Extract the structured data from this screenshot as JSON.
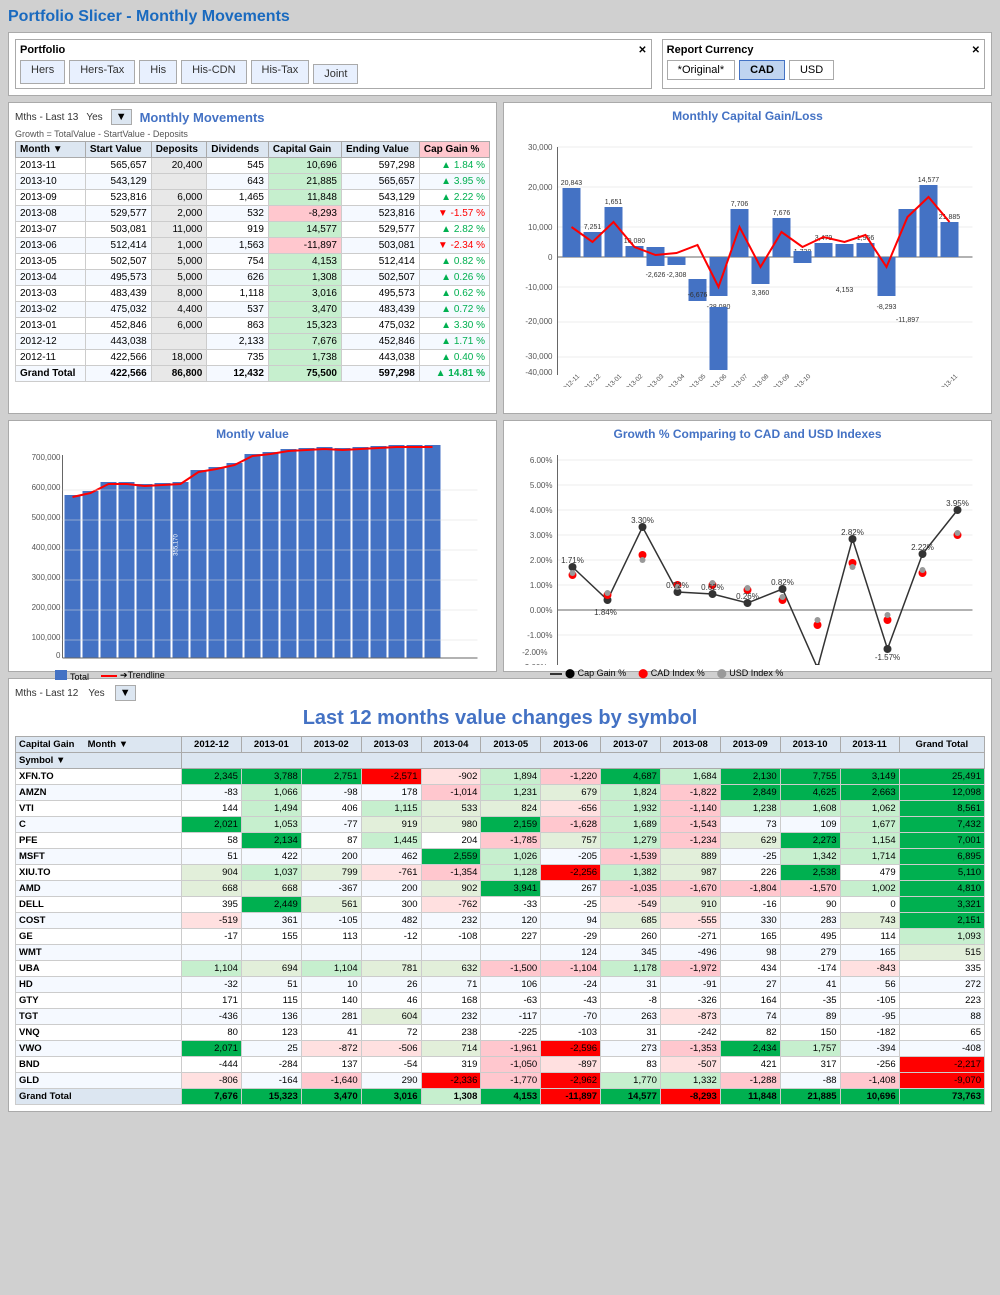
{
  "title": "Portfolio Slicer - Monthly Movements",
  "portfolio_slicer": {
    "label": "Portfolio",
    "items": [
      "Hers",
      "Hers-Tax",
      "His",
      "His-CDN",
      "His-Tax",
      "Joint"
    ]
  },
  "report_currency": {
    "label": "Report Currency",
    "items": [
      "*Original*",
      "CAD",
      "USD"
    ],
    "selected": "CAD"
  },
  "monthly_movements": {
    "title": "Monthly Movements",
    "filter_label": "Mths - Last 13",
    "filter_yes": "Yes",
    "note": "Growth = TotalValue - StartValue - Deposits",
    "columns": [
      "Month",
      "Start Value",
      "Deposits",
      "Dividends",
      "Capital Gain",
      "Ending Value",
      "Cap Gain %"
    ],
    "rows": [
      {
        "month": "2013-11",
        "start": "565,657",
        "deposits": "20,400",
        "dividends": "545",
        "cap_gain": "10,696",
        "ending": "597,298",
        "pct": "1.84 %",
        "dir": "up"
      },
      {
        "month": "2013-10",
        "start": "543,129",
        "deposits": "",
        "dividends": "643",
        "cap_gain": "21,885",
        "ending": "565,657",
        "pct": "3.95 %",
        "dir": "up"
      },
      {
        "month": "2013-09",
        "start": "523,816",
        "deposits": "6,000",
        "dividends": "1,465",
        "cap_gain": "11,848",
        "ending": "543,129",
        "pct": "2.22 %",
        "dir": "up"
      },
      {
        "month": "2013-08",
        "start": "529,577",
        "deposits": "2,000",
        "dividends": "532",
        "cap_gain": "-8,293",
        "ending": "523,816",
        "pct": "-1.57 %",
        "dir": "down"
      },
      {
        "month": "2013-07",
        "start": "503,081",
        "deposits": "11,000",
        "dividends": "919",
        "cap_gain": "14,577",
        "ending": "529,577",
        "pct": "2.82 %",
        "dir": "up"
      },
      {
        "month": "2013-06",
        "start": "512,414",
        "deposits": "1,000",
        "dividends": "1,563",
        "cap_gain": "-11,897",
        "ending": "503,081",
        "pct": "-2.34 %",
        "dir": "down"
      },
      {
        "month": "2013-05",
        "start": "502,507",
        "deposits": "5,000",
        "dividends": "754",
        "cap_gain": "4,153",
        "ending": "512,414",
        "pct": "0.82 %",
        "dir": "up"
      },
      {
        "month": "2013-04",
        "start": "495,573",
        "deposits": "5,000",
        "dividends": "626",
        "cap_gain": "1,308",
        "ending": "502,507",
        "pct": "0.26 %",
        "dir": "up"
      },
      {
        "month": "2013-03",
        "start": "483,439",
        "deposits": "8,000",
        "dividends": "1,118",
        "cap_gain": "3,016",
        "ending": "495,573",
        "pct": "0.62 %",
        "dir": "up"
      },
      {
        "month": "2013-02",
        "start": "475,032",
        "deposits": "4,400",
        "dividends": "537",
        "cap_gain": "3,470",
        "ending": "483,439",
        "pct": "0.72 %",
        "dir": "up"
      },
      {
        "month": "2013-01",
        "start": "452,846",
        "deposits": "6,000",
        "dividends": "863",
        "cap_gain": "15,323",
        "ending": "475,032",
        "pct": "3.30 %",
        "dir": "up"
      },
      {
        "month": "2012-12",
        "start": "443,038",
        "deposits": "",
        "dividends": "2,133",
        "cap_gain": "7,676",
        "ending": "452,846",
        "pct": "1.71 %",
        "dir": "up"
      },
      {
        "month": "2012-11",
        "start": "422,566",
        "deposits": "18,000",
        "dividends": "735",
        "cap_gain": "1,738",
        "ending": "443,038",
        "pct": "0.40 %",
        "dir": "up"
      }
    ],
    "grand_total": {
      "start": "422,566",
      "deposits": "86,800",
      "dividends": "12,432",
      "cap_gain": "75,500",
      "ending": "597,298",
      "pct": "14.81 %"
    }
  },
  "last12_section": {
    "filter_label": "Mths - Last 12",
    "filter_yes": "Yes",
    "title": "Last 12 months value changes by symbol",
    "col_header": "Capital Gain",
    "month_header": "Month",
    "columns": [
      "Symbol",
      "2012-12",
      "2013-01",
      "2013-02",
      "2013-03",
      "2013-04",
      "2013-05",
      "2013-06",
      "2013-07",
      "2013-08",
      "2013-09",
      "2013-10",
      "2013-11",
      "Grand Total"
    ],
    "rows": [
      {
        "symbol": "XFN.TO",
        "vals": [
          2345,
          3788,
          2751,
          -2571,
          -902,
          1894,
          -1220,
          4687,
          1684,
          2130,
          7755,
          3149,
          25491
        ]
      },
      {
        "symbol": "AMZN",
        "vals": [
          -83,
          1066,
          -98,
          178,
          -1014,
          1231,
          679,
          1824,
          -1822,
          2849,
          4625,
          2663,
          12098
        ]
      },
      {
        "symbol": "VTI",
        "vals": [
          144,
          1494,
          406,
          1115,
          533,
          824,
          -656,
          1932,
          -1140,
          1238,
          1608,
          1062,
          8561
        ]
      },
      {
        "symbol": "C",
        "vals": [
          2021,
          1053,
          -77,
          919,
          980,
          2159,
          -1628,
          1689,
          -1543,
          73,
          109,
          1677,
          7432
        ]
      },
      {
        "symbol": "PFE",
        "vals": [
          58,
          2134,
          87,
          1445,
          204,
          -1785,
          757,
          1279,
          -1234,
          629,
          2273,
          1154,
          7001
        ]
      },
      {
        "symbol": "MSFT",
        "vals": [
          51,
          422,
          200,
          462,
          2559,
          1026,
          -205,
          -1539,
          889,
          -25,
          1342,
          1714,
          6895
        ]
      },
      {
        "symbol": "XIU.TO",
        "vals": [
          904,
          1037,
          799,
          -761,
          -1354,
          1128,
          -2256,
          1382,
          987,
          226,
          2538,
          479,
          5110
        ]
      },
      {
        "symbol": "AMD",
        "vals": [
          668,
          668,
          -367,
          200,
          902,
          3941,
          267,
          -1035,
          -1670,
          -1804,
          -1570,
          1002,
          4810
        ]
      },
      {
        "symbol": "DELL",
        "vals": [
          395,
          2449,
          561,
          300,
          -762,
          -33,
          -25,
          -549,
          910,
          -16,
          90,
          0,
          3321
        ]
      },
      {
        "symbol": "COST",
        "vals": [
          -519,
          361,
          -105,
          482,
          232,
          120,
          94,
          685,
          -555,
          330,
          283,
          743,
          2151
        ]
      },
      {
        "symbol": "GE",
        "vals": [
          -17,
          155,
          113,
          -12,
          -108,
          227,
          -29,
          260,
          -271,
          165,
          495,
          114,
          1093
        ]
      },
      {
        "symbol": "WMT",
        "vals": [
          null,
          null,
          null,
          null,
          null,
          null,
          124,
          345,
          -496,
          98,
          279,
          165,
          515
        ]
      },
      {
        "symbol": "UBA",
        "vals": [
          1104,
          694,
          1104,
          781,
          632,
          -1500,
          -1104,
          1178,
          -1972,
          434,
          -174,
          -843,
          335
        ]
      },
      {
        "symbol": "HD",
        "vals": [
          -32,
          51,
          10,
          26,
          71,
          106,
          -24,
          31,
          -91,
          27,
          41,
          56,
          272
        ]
      },
      {
        "symbol": "GTY",
        "vals": [
          171,
          115,
          140,
          46,
          168,
          -63,
          -43,
          -8,
          -326,
          164,
          -35,
          -105,
          223
        ]
      },
      {
        "symbol": "TGT",
        "vals": [
          -436,
          136,
          281,
          604,
          232,
          -117,
          -70,
          263,
          -873,
          74,
          89,
          -95,
          88
        ]
      },
      {
        "symbol": "VNQ",
        "vals": [
          80,
          123,
          41,
          72,
          238,
          -225,
          -103,
          31,
          -242,
          82,
          150,
          -182,
          65
        ]
      },
      {
        "symbol": "VWO",
        "vals": [
          2071,
          25,
          -872,
          -506,
          714,
          -1961,
          -2596,
          273,
          -1353,
          2434,
          1757,
          -394,
          -408
        ]
      },
      {
        "symbol": "BND",
        "vals": [
          -444,
          -284,
          137,
          -54,
          319,
          -1050,
          -897,
          83,
          -507,
          421,
          317,
          -256,
          -2217
        ]
      },
      {
        "symbol": "GLD",
        "vals": [
          -806,
          -164,
          -1640,
          290,
          -2336,
          -1770,
          -2962,
          1770,
          1332,
          -1288,
          -88,
          -1408,
          -9070
        ]
      }
    ],
    "grand_total_row": [
      7676,
      15323,
      3470,
      3016,
      1308,
      4153,
      -11897,
      14577,
      -8293,
      11848,
      21885,
      10696,
      73763
    ]
  },
  "monthly_chart": {
    "title": "Monthly Capital Gain/Loss",
    "bar_values": [
      20843,
      1651,
      -2626,
      -2308,
      -6676,
      -28080,
      1738,
      3470,
      1308,
      4153,
      -11897,
      14577,
      -8293,
      11848,
      15323,
      4153,
      1956,
      10696,
      14577,
      21885,
      10696
    ]
  },
  "monthly_value_chart": {
    "title": "Montly value",
    "legend_total": "Total",
    "legend_trend": "Trendline"
  },
  "growth_chart": {
    "title": "Growth % Comparing to CAD and USD Indexes",
    "legend": [
      "Cap Gain %",
      "CAD Index %",
      "USD Index %"
    ]
  }
}
